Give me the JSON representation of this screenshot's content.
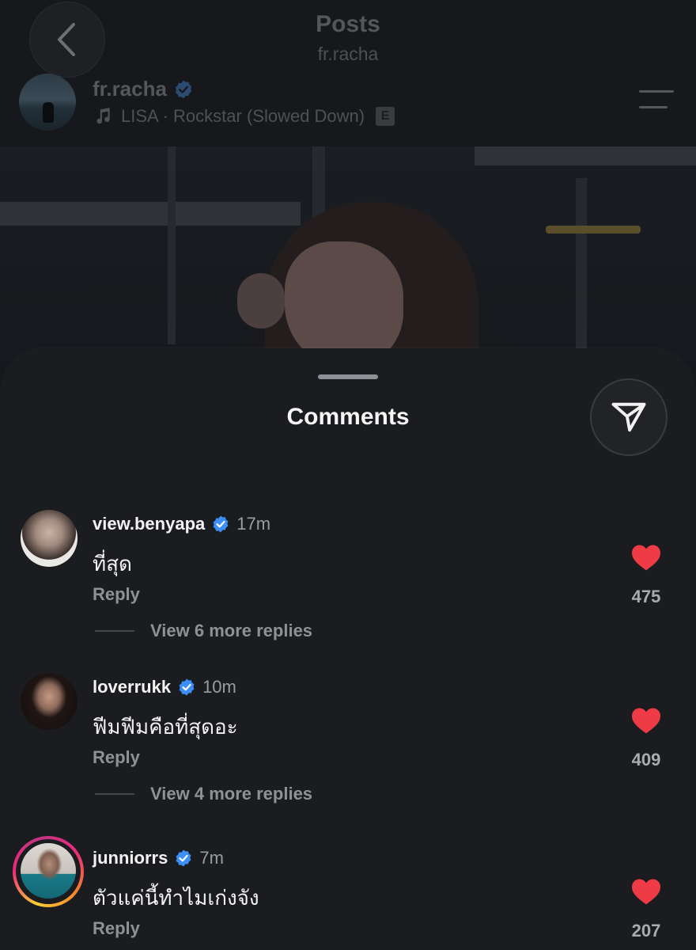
{
  "header": {
    "title": "Posts",
    "subtitle": "fr.racha"
  },
  "post": {
    "username": "fr.racha",
    "music": "LISA · Rockstar (Slowed Down)",
    "explicit_badge": "E"
  },
  "sheet": {
    "title": "Comments"
  },
  "colors": {
    "accent_verified": "#3b8ff6",
    "like_red": "#ee3b45",
    "sheet_bg": "#1b1c1f"
  },
  "comments": [
    {
      "username": "view.benyapa",
      "time": "17m",
      "text": "ที่สุด",
      "reply_label": "Reply",
      "likes": "475",
      "more_replies": "View 6 more replies"
    },
    {
      "username": "loverrukk",
      "time": "10m",
      "text": "ฟีมฟีมคือที่สุดอะ",
      "reply_label": "Reply",
      "likes": "409",
      "more_replies": "View 4 more replies"
    },
    {
      "username": "junniorrs",
      "time": "7m",
      "text": "ตัวแค่นี้ทำไมเก่งจัง",
      "reply_label": "Reply",
      "likes": "207"
    }
  ]
}
